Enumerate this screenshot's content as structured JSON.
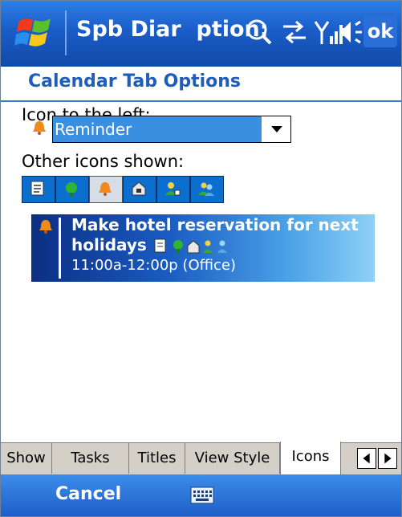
{
  "titlebar": {
    "title": "Spb Diar   ption:",
    "ok_label": "ok",
    "icons": [
      "windows-flag-icon",
      "search-icon",
      "connectivity-icon",
      "signal-icon",
      "speaker-icon"
    ]
  },
  "header": {
    "title": "Calendar Tab Options"
  },
  "icon_left": {
    "label": "Icon to the left:",
    "selected": "Reminder"
  },
  "other_icons": {
    "label": "Other icons shown:",
    "buttons": [
      "note-icon",
      "recurring-icon",
      "reminder-icon",
      "private-icon",
      "attendees-icon",
      "meeting-icon"
    ],
    "pressed": "reminder-icon"
  },
  "appointment": {
    "title_line1": "Make hotel reservation for next",
    "title_line2": "holidays",
    "time": "11:00a-12:00p (Office)"
  },
  "tabs": [
    "Show",
    "Tasks",
    "Titles",
    "View Style",
    "Icons"
  ],
  "active_tab": "Icons",
  "menubar": {
    "left": "Cancel"
  },
  "colors": {
    "accent": "#1a5cc8",
    "header_text": "#1f5dbd",
    "selection": "#3a8fe0"
  }
}
